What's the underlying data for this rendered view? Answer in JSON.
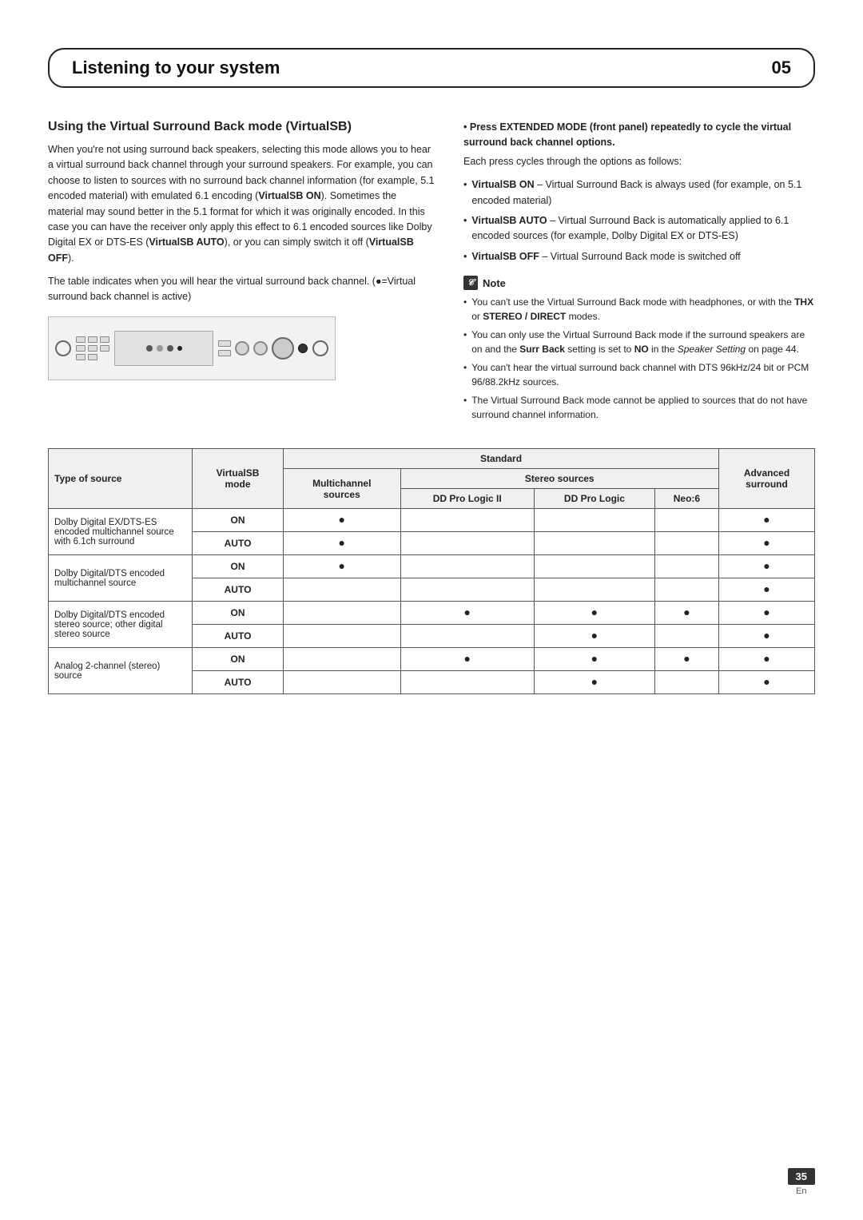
{
  "header": {
    "title": "Listening to your system",
    "number": "05"
  },
  "section": {
    "heading": "Using the Virtual Surround Back mode (VirtualSB)",
    "intro_paragraph": "When you're not using surround back speakers, selecting this mode allows you to hear a virtual surround back channel through your surround speakers. For example, you can choose to listen to sources with no surround back channel information (for example, 5.1 encoded material) with emulated 6.1 encoding (VirtualSB ON). Sometimes the material may sound better in the 5.1 format for which it was originally encoded. In this case you can have the receiver only apply this effect to 6.1 encoded sources like Dolby Digital EX or DTS-ES (VirtualSB AUTO), or you can simply switch it off (VirtualSB OFF).",
    "second_paragraph": "The table indicates when you will hear the virtual surround back channel. (●=Virtual surround back channel is active)"
  },
  "right_col": {
    "press_instruction": "Press EXTENDED MODE (front panel) repeatedly to cycle the virtual surround back channel options.",
    "press_sub": "Each press cycles through the options as follows:",
    "bullets": [
      {
        "label": "VirtualSB ON",
        "text": " – Virtual Surround Back is always used (for example, on 5.1 encoded material)"
      },
      {
        "label": "VirtualSB AUTO",
        "text": " – Virtual Surround Back is automatically applied to 6.1 encoded sources (for example, Dolby Digital EX or DTS-ES)"
      },
      {
        "label": "VirtualSB OFF",
        "text": " – Virtual Surround Back mode is switched off"
      }
    ],
    "note": {
      "title": "Note",
      "items": [
        "You can't use the Virtual Surround Back mode with headphones, or with the THX or STEREO / DIRECT modes.",
        "You can only use the Virtual Surround Back mode if the surround speakers are on and the Surr Back setting is set to NO in the Speaker Setting on page 44.",
        "You can't hear the virtual surround back channel with DTS 96kHz/24 bit or PCM 96/88.2kHz sources.",
        "The Virtual Surround Back mode cannot be applied to sources that do not have surround channel information."
      ]
    }
  },
  "table": {
    "col_headers": {
      "type_of_source": "Type of source",
      "virtualSB_mode": "VirtualSB mode",
      "standard": "Standard",
      "multichannel_sources": "Multichannel sources",
      "stereo_sources": "Stereo sources",
      "pro_logic_2": "DD Pro Logic II",
      "pro_logic": "DD Pro Logic",
      "neo6": "Neo:6",
      "advanced_surround": "Advanced surround"
    },
    "rows": [
      {
        "type": "Dolby Digital EX/DTS-ES encoded multichannel source with 6.1ch surround",
        "on": {
          "vsb": true,
          "mc": false,
          "pl2": false,
          "pl": false,
          "neo": false,
          "adv": true
        },
        "auto": {
          "vsb": true,
          "mc": false,
          "pl2": false,
          "pl": false,
          "neo": false,
          "adv": true
        },
        "mode_on": "ON",
        "mode_auto": "AUTO"
      },
      {
        "type": "Dolby Digital/DTS encoded multichannel source",
        "on": {
          "vsb": true,
          "mc": true,
          "pl2": false,
          "pl": false,
          "neo": false,
          "adv": true
        },
        "auto": {
          "vsb": false,
          "mc": false,
          "pl2": false,
          "pl": false,
          "neo": false,
          "adv": true
        },
        "mode_on": "ON",
        "mode_auto": "AUTO"
      },
      {
        "type": "Dolby Digital/DTS encoded stereo source; other digital stereo source",
        "on": {
          "vsb": false,
          "mc": false,
          "pl2": true,
          "pl": true,
          "neo": true,
          "adv": true
        },
        "auto": {
          "vsb": false,
          "mc": false,
          "pl2": false,
          "pl": true,
          "neo": false,
          "adv": true
        },
        "mode_on": "ON",
        "mode_auto": "AUTO"
      },
      {
        "type": "Analog 2-channel (stereo) source",
        "on": {
          "vsb": false,
          "mc": false,
          "pl2": true,
          "pl": true,
          "neo": true,
          "adv": true
        },
        "auto": {
          "vsb": false,
          "mc": false,
          "pl2": false,
          "pl": true,
          "neo": false,
          "adv": true
        },
        "mode_on": "ON",
        "mode_auto": "AUTO"
      }
    ]
  },
  "page_number": "35",
  "page_lang": "En"
}
